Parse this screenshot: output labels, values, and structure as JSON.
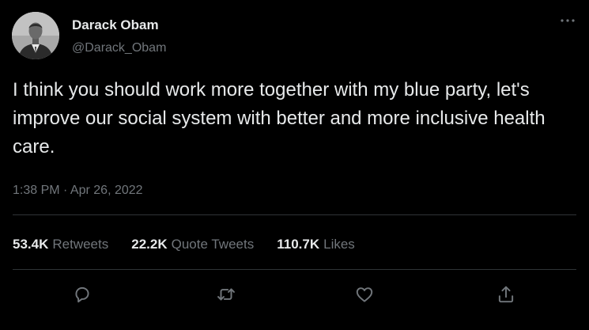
{
  "author": {
    "display_name": "Darack Obam",
    "handle": "@Darack_Obam"
  },
  "tweet": {
    "text": "I think you should work more together with my blue party, let's improve our social system with better and more inclusive health care.",
    "timestamp": "1:38 PM · Apr 26, 2022"
  },
  "stats": [
    {
      "count": "53.4K",
      "label": "Retweets"
    },
    {
      "count": "22.2K",
      "label": "Quote Tweets"
    },
    {
      "count": "110.7K",
      "label": "Likes"
    }
  ],
  "actions": [
    "reply-icon",
    "retweet-icon",
    "like-icon",
    "share-icon"
  ],
  "icons": {
    "more": "more-horizontal-icon"
  },
  "colors": {
    "background": "#000000",
    "text_primary": "#e7e9ea",
    "text_secondary": "#71767b",
    "divider": "#2f3336"
  }
}
